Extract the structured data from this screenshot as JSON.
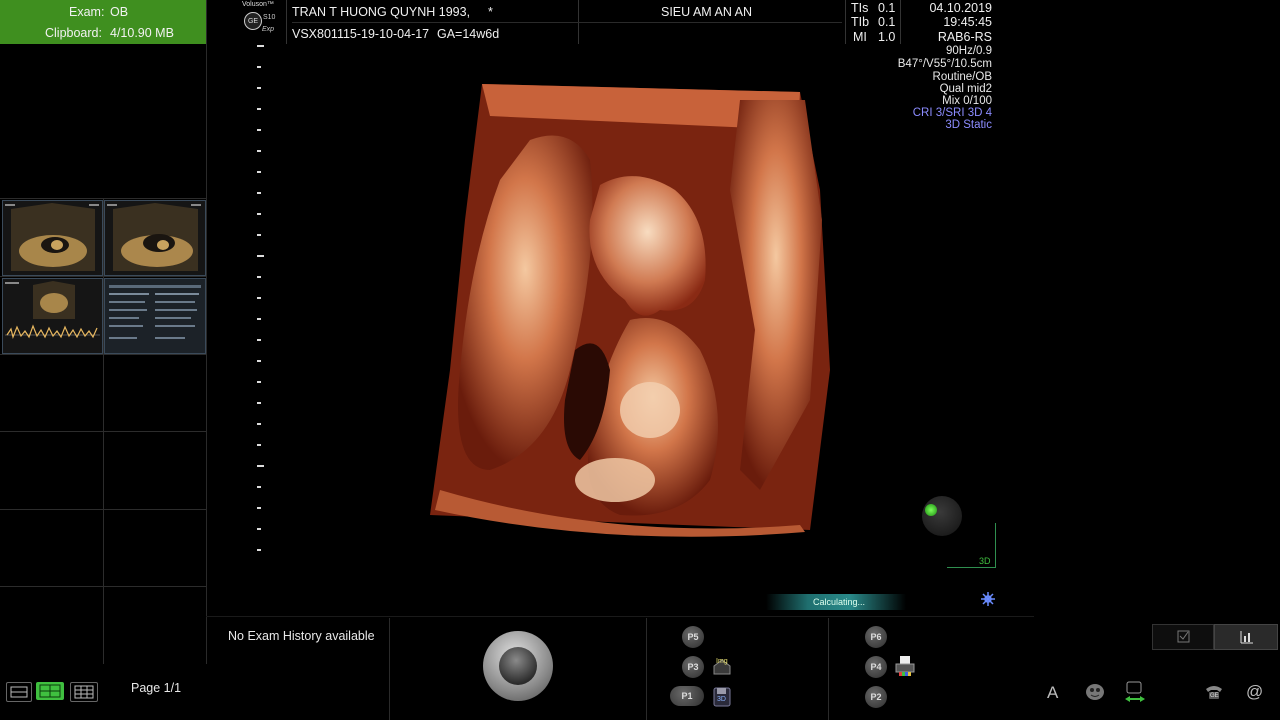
{
  "left_panel": {
    "exam_label": "Exam:",
    "exam_value": "OB",
    "clipboard_label": "Clipboard:",
    "clipboard_value": "4/10.90 MB",
    "page_label": "Page 1/1"
  },
  "header": {
    "brand_line1": "Voluson™",
    "brand_line2": "S10",
    "brand_line3": "Exp",
    "patient_name": "TRAN T HUONG QUYNH 1993,",
    "patient_marker": "*",
    "patient_id": "VSX801115-19-10-04-17",
    "gestational_age": "GA=14w6d",
    "institution": "SIEU AM AN AN",
    "tis_label": "TIs",
    "tis_value": "0.1",
    "tib_label": "TIb",
    "tib_value": "0.1",
    "mi_label": "MI",
    "mi_value": "1.0",
    "date": "04.10.2019",
    "time": "19:45:45",
    "probe": "RAB6-RS"
  },
  "params": {
    "frame_rate": "90Hz/0.9",
    "angles": "B47°/V55°/10.5cm",
    "preset": "Routine/OB",
    "quality": "Qual mid2",
    "mix": "Mix 0/100",
    "cri_sri": "CRI 3/SRI 3D 4",
    "mode": "3D Static"
  },
  "image": {
    "orientation_label": "3D",
    "status_text": "Calculating..."
  },
  "bottom": {
    "exam_history": "No Exam History available",
    "p5": "P5",
    "p3": "P3",
    "p1": "P1",
    "p6": "P6",
    "p4": "P4",
    "p2": "P2",
    "img_label": "Img",
    "icon_3d_label": "3D",
    "text_tool_label": "A",
    "ge_label": "GE"
  },
  "colors": {
    "exam_box": "#3f8f1f",
    "param_highlight": "#8c8cff",
    "status_bar": "#2a8a8a",
    "active_layout": "#3fbf3f"
  },
  "thumbnails": [
    {
      "name": "ultrasound-thumbnail-1"
    },
    {
      "name": "ultrasound-thumbnail-2"
    },
    {
      "name": "doppler-thumbnail-3"
    },
    {
      "name": "report-thumbnail-4"
    }
  ]
}
